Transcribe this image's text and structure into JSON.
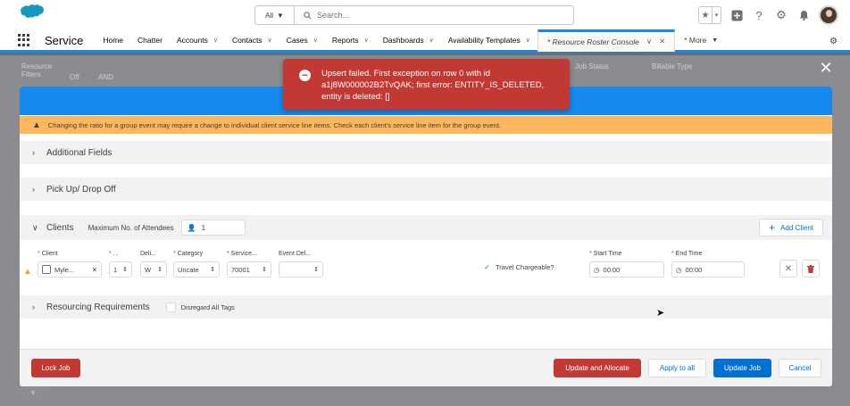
{
  "global_header": {
    "search_scope": "All",
    "search_placeholder": "Search..."
  },
  "navbar": {
    "app_name": "Service",
    "items": [
      {
        "label": "Home",
        "has_menu": false
      },
      {
        "label": "Chatter",
        "has_menu": false
      },
      {
        "label": "Accounts",
        "has_menu": true
      },
      {
        "label": "Contacts",
        "has_menu": true
      },
      {
        "label": "Cases",
        "has_menu": true
      },
      {
        "label": "Reports",
        "has_menu": true
      },
      {
        "label": "Dashboards",
        "has_menu": true
      },
      {
        "label": "Availability Templates",
        "has_menu": true
      }
    ],
    "active_tab": "* Resource Roster Console",
    "more_label": "* More"
  },
  "background_filters": {
    "resource_filters": "Resource Filters",
    "off": "Off",
    "and": "AND",
    "job_status": "Job Status",
    "billable_type": "Billable Type"
  },
  "toast": {
    "message": "Upsert failed. First exception on row 0 with id a1j8W000002B2TvQAK; first error: ENTITY_IS_DELETED, entity is deleted: []"
  },
  "modal": {
    "warning": "Changing the ratio for a group event may require a change to individual client service line items. Check each client's service line item for the group event.",
    "sections": {
      "additional_fields": "Additional Fields",
      "pickup_dropoff": "Pick Up/ Drop Off",
      "clients": "Clients",
      "resourcing": "Resourcing Requirements"
    },
    "max_attendees_label": "Maximum No. of Attendees",
    "max_attendees_value": "1",
    "add_client_label": "Add Client",
    "disregard_tags_label": "Disregard All Tags",
    "client_row": {
      "labels": {
        "client": "Client",
        "ratio": "...",
        "delivery": "Deli...",
        "category": "Category",
        "service": "Service...",
        "event_del": "Event Del...",
        "start_time": "Start Time",
        "end_time": "End Time"
      },
      "values": {
        "client": "Myle...",
        "ratio": "1",
        "delivery": "W",
        "category": "Uncate",
        "service": "70001",
        "event_del": "",
        "start_time": "00:00",
        "end_time": "00:00"
      },
      "travel_chargeable_label": "Travel Chargeable?"
    },
    "footer": {
      "lock_job": "Lock Job",
      "update_allocate": "Update and Allocate",
      "apply_all": "Apply to all",
      "update_job": "Update Job",
      "cancel": "Cancel"
    }
  },
  "colors": {
    "brand_blue": "#1589ee",
    "button_blue": "#0070d2",
    "error_red": "#c23934",
    "warning_orange": "#ffb75d"
  },
  "icons": [
    "salesforce-cloud-icon",
    "search-icon",
    "star-icon",
    "plus-square-icon",
    "help-icon",
    "gear-icon",
    "bell-icon",
    "close-icon",
    "warning-icon",
    "user-icon",
    "clock-icon",
    "delete-icon",
    "error-icon"
  ]
}
